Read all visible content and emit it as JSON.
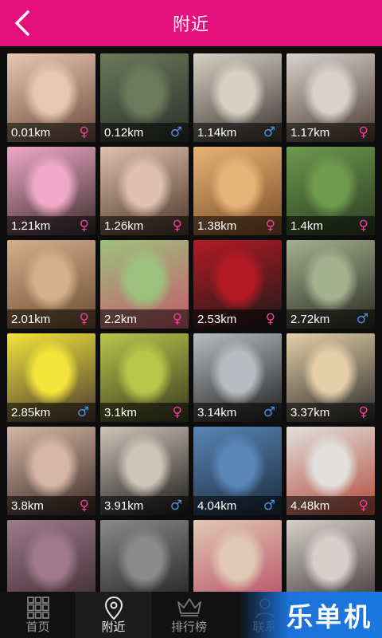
{
  "header": {
    "title": "附近"
  },
  "tiles": [
    {
      "distance": "0.01km",
      "gender": "♀",
      "g": "f",
      "c1": "#e8c7b2",
      "c2": "#6b4a3a"
    },
    {
      "distance": "0.12km",
      "gender": "♂",
      "g": "m",
      "c1": "#6c7a5c",
      "c2": "#2a2e2a"
    },
    {
      "distance": "1.14km",
      "gender": "♂",
      "g": "m",
      "c1": "#d7d1c4",
      "c2": "#3a3530"
    },
    {
      "distance": "1.17km",
      "gender": "♀",
      "g": "f",
      "c1": "#d9d2cc",
      "c2": "#4a3a32"
    },
    {
      "distance": "1.21km",
      "gender": "♀",
      "g": "f",
      "c1": "#f0a9c8",
      "c2": "#3a2a2a"
    },
    {
      "distance": "1.26km",
      "gender": "♀",
      "g": "f",
      "c1": "#e0c0ae",
      "c2": "#4a3628"
    },
    {
      "distance": "1.38km",
      "gender": "♀",
      "g": "f",
      "c1": "#e7b477",
      "c2": "#7a4a24"
    },
    {
      "distance": "1.4km",
      "gender": "♀",
      "g": "f",
      "c1": "#6e9a4e",
      "c2": "#2a3a22"
    },
    {
      "distance": "2.01km",
      "gender": "♀",
      "g": "f",
      "c1": "#d4b08c",
      "c2": "#6a4c30"
    },
    {
      "distance": "2.2km",
      "gender": "♀",
      "g": "f",
      "c1": "#9ec07e",
      "c2": "#c45a6a"
    },
    {
      "distance": "2.53km",
      "gender": "♀",
      "g": "f",
      "c1": "#b41a24",
      "c2": "#1a1a1a"
    },
    {
      "distance": "2.72km",
      "gender": "♂",
      "g": "m",
      "c1": "#a4b08e",
      "c2": "#2a2a22"
    },
    {
      "distance": "2.85km",
      "gender": "♂",
      "g": "m",
      "c1": "#f2e43a",
      "c2": "#4a3a30"
    },
    {
      "distance": "3.1km",
      "gender": "♀",
      "g": "f",
      "c1": "#b6c74a",
      "c2": "#3a3a20"
    },
    {
      "distance": "3.14km",
      "gender": "♂",
      "g": "m",
      "c1": "#b8bcc0",
      "c2": "#1e1e1e"
    },
    {
      "distance": "3.37km",
      "gender": "♀",
      "g": "f",
      "c1": "#e4cfa8",
      "c2": "#2a2a2a"
    },
    {
      "distance": "3.8km",
      "gender": "♀",
      "g": "f",
      "c1": "#d6b6a6",
      "c2": "#3a2a24"
    },
    {
      "distance": "3.91km",
      "gender": "♂",
      "g": "m",
      "c1": "#cfc4b8",
      "c2": "#1a1a1a"
    },
    {
      "distance": "4.04km",
      "gender": "♂",
      "g": "m",
      "c1": "#5a86b8",
      "c2": "#1a2a3a"
    },
    {
      "distance": "4.48km",
      "gender": "♀",
      "g": "f",
      "c1": "#e2e0dc",
      "c2": "#b24a3a"
    },
    {
      "distance": "",
      "gender": "",
      "g": "f",
      "c1": "#a07a8a",
      "c2": "#3a2a30"
    },
    {
      "distance": "",
      "gender": "",
      "g": "f",
      "c1": "#8a8a8a",
      "c2": "#1e1e1e"
    },
    {
      "distance": "",
      "gender": "",
      "g": "f",
      "c1": "#e0c8b4",
      "c2": "#b84a62"
    },
    {
      "distance": "",
      "gender": "",
      "g": "f",
      "c1": "#d6d0cc",
      "c2": "#3a3434"
    }
  ],
  "tabbar": {
    "home": "首页",
    "nearby": "附近",
    "ranking": "排行榜",
    "contacts": "联系"
  },
  "brand": {
    "text": "乐单机"
  },
  "colors": {
    "accent": "#e4117c",
    "female": "#ee3f9b",
    "male": "#4a8fe0",
    "brand_blue": "#1a78e0"
  }
}
